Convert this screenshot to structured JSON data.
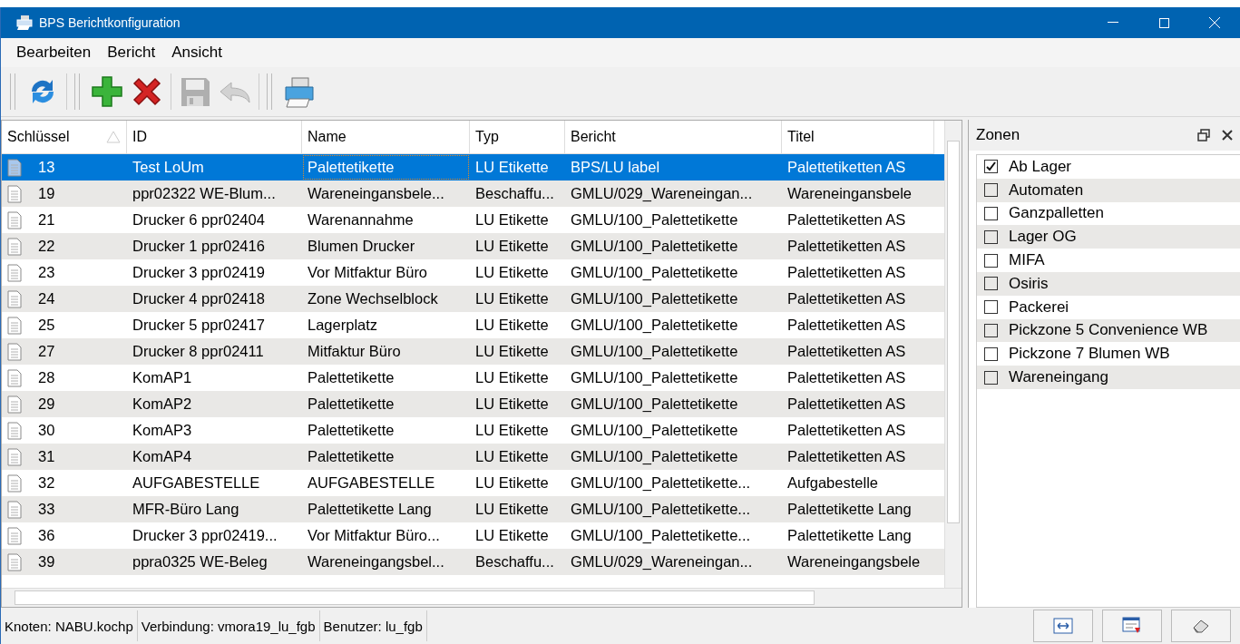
{
  "window": {
    "title": "BPS Berichtkonfiguration"
  },
  "menu": [
    "Bearbeiten",
    "Bericht",
    "Ansicht"
  ],
  "toolbar": [
    {
      "kind": "refresh",
      "disabled": false
    },
    {
      "kind": "add",
      "disabled": false
    },
    {
      "kind": "delete",
      "disabled": false
    },
    {
      "kind": "save",
      "disabled": true
    },
    {
      "kind": "undo",
      "disabled": true
    },
    {
      "kind": "print",
      "disabled": false
    }
  ],
  "table": {
    "columns": [
      "Schlüssel",
      "ID",
      "Name",
      "Typ",
      "Bericht",
      "Titel"
    ],
    "rows": [
      {
        "selected": true,
        "cells": [
          "13",
          "Test LoUm",
          "Palettetikette",
          "LU Etikette",
          "BPS/LU label",
          "Palettetiketten AS"
        ]
      },
      {
        "selected": false,
        "cells": [
          "19",
          "ppr02322 WE-Blum...",
          "Wareneingansbele...",
          "Beschaffu...",
          "GMLU/029_Wareneingan...",
          "Wareneingansbele"
        ]
      },
      {
        "selected": false,
        "cells": [
          "21",
          "Drucker 6 ppr02404",
          "Warenannahme",
          "LU Etikette",
          "GMLU/100_Palettetikette",
          "Palettetiketten AS"
        ]
      },
      {
        "selected": false,
        "cells": [
          "22",
          "Drucker 1 ppr02416",
          "Blumen Drucker",
          "LU Etikette",
          "GMLU/100_Palettetikette",
          "Palettetiketten AS"
        ]
      },
      {
        "selected": false,
        "cells": [
          "23",
          "Drucker 3  ppr02419",
          "Vor Mitfaktur Büro",
          "LU Etikette",
          "GMLU/100_Palettetikette",
          "Palettetiketten AS"
        ]
      },
      {
        "selected": false,
        "cells": [
          "24",
          "Drucker 4 ppr02418",
          "Zone Wechselblock",
          "LU Etikette",
          "GMLU/100_Palettetikette",
          "Palettetiketten AS"
        ]
      },
      {
        "selected": false,
        "cells": [
          "25",
          "Drucker 5 ppr02417",
          "Lagerplatz",
          "LU Etikette",
          "GMLU/100_Palettetikette",
          "Palettetiketten AS"
        ]
      },
      {
        "selected": false,
        "cells": [
          "27",
          "Drucker 8 ppr02411",
          "Mitfaktur Büro",
          "LU Etikette",
          "GMLU/100_Palettetikette",
          "Palettetiketten AS"
        ]
      },
      {
        "selected": false,
        "cells": [
          "28",
          "KomAP1",
          "Palettetikette",
          "LU Etikette",
          "GMLU/100_Palettetikette",
          "Palettetiketten AS"
        ]
      },
      {
        "selected": false,
        "cells": [
          "29",
          "KomAP2",
          "Palettetikette",
          "LU Etikette",
          "GMLU/100_Palettetikette",
          "Palettetiketten AS"
        ]
      },
      {
        "selected": false,
        "cells": [
          "30",
          "KomAP3",
          "Palettetikette",
          "LU Etikette",
          "GMLU/100_Palettetikette",
          "Palettetiketten AS"
        ]
      },
      {
        "selected": false,
        "cells": [
          "31",
          "KomAP4",
          "Palettetikette",
          "LU Etikette",
          "GMLU/100_Palettetikette",
          "Palettetiketten AS"
        ]
      },
      {
        "selected": false,
        "cells": [
          "32",
          "AUFGABESTELLE",
          "AUFGABESTELLE",
          "LU Etikette",
          "GMLU/100_Palettetikette...",
          "Aufgabestelle"
        ]
      },
      {
        "selected": false,
        "cells": [
          "33",
          "MFR-Büro Lang",
          "Palettetikette Lang",
          "LU Etikette",
          "GMLU/100_Palettetikette...",
          "Palettetikette Lang"
        ]
      },
      {
        "selected": false,
        "cells": [
          "36",
          "Drucker 3 ppr02419...",
          "Vor Mitfaktur Büro...",
          "LU Etikette",
          "GMLU/100_Palettetikette...",
          "Palettetikette Lang"
        ]
      },
      {
        "selected": false,
        "cells": [
          "39",
          "ppra0325 WE-Beleg",
          "Wareneingangsbel...",
          "Beschaffu...",
          "GMLU/029_Wareneingan...",
          "Wareneingangsbele"
        ]
      }
    ]
  },
  "zones": {
    "title": "Zonen",
    "items": [
      {
        "label": "Ab Lager",
        "checked": true
      },
      {
        "label": "Automaten",
        "checked": false
      },
      {
        "label": "Ganzpalletten",
        "checked": false
      },
      {
        "label": "Lager OG",
        "checked": false
      },
      {
        "label": "MIFA",
        "checked": false
      },
      {
        "label": "Osiris",
        "checked": false
      },
      {
        "label": "Packerei",
        "checked": false
      },
      {
        "label": "Pickzone 5 Convenience WB",
        "checked": false
      },
      {
        "label": "Pickzone 7 Blumen WB",
        "checked": false
      },
      {
        "label": "Wareneingang",
        "checked": false
      }
    ]
  },
  "status_bar": [
    "Knoten: NABU.kochp",
    "Verbindung: vmora19_lu_fgb",
    "Benutzer: lu_fgb"
  ],
  "status_buttons": [
    {
      "kind": "fit"
    },
    {
      "kind": "export"
    },
    {
      "kind": "clear"
    }
  ]
}
